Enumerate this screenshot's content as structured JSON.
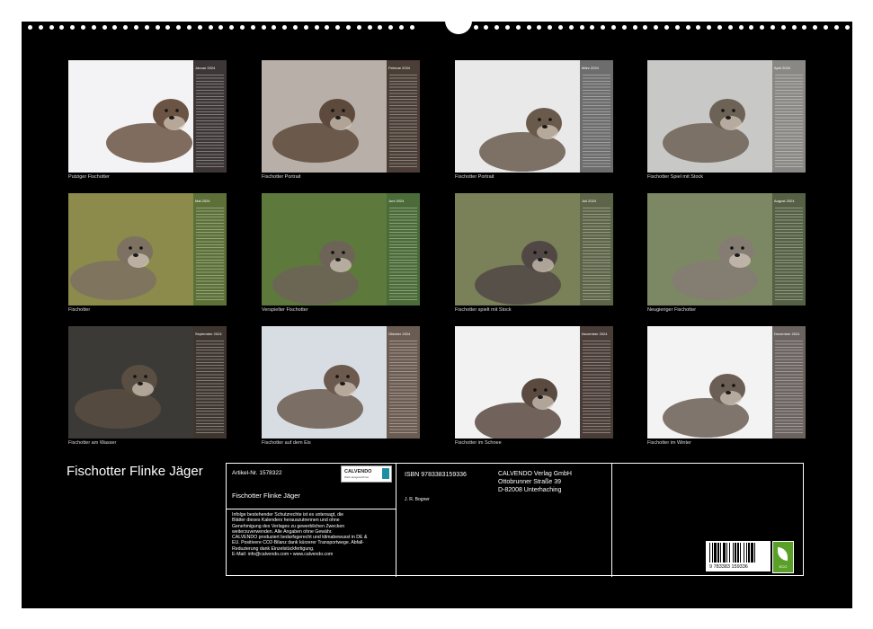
{
  "months": [
    {
      "label": "Januar 2024",
      "caption": "Putziger Fischotter",
      "strip_color": "#3d3636",
      "bg": "#f3f3f5"
    },
    {
      "label": "Februar 2024",
      "caption": "Fischotter Portrait",
      "strip_color": "#4a3e37",
      "bg": "#b8b0a8"
    },
    {
      "label": "März 2024",
      "caption": "Fischotter Portrait",
      "strip_color": "#6d6d6d",
      "bg": "#e9e9ea"
    },
    {
      "label": "April 2024",
      "caption": "Fischotter Spiel mit Stock",
      "strip_color": "#8a8885",
      "bg": "#c8c8c6"
    },
    {
      "label": "Mai 2024",
      "caption": "Fischotter",
      "strip_color": "#5c7038",
      "bg": "#8c8b4b"
    },
    {
      "label": "Juni 2024",
      "caption": "Verspielter Fischotter",
      "strip_color": "#4b6b38",
      "bg": "#5d7a3c"
    },
    {
      "label": "Juli 2024",
      "caption": "Fischotter spielt mit Stock",
      "strip_color": "#5e6448",
      "bg": "#7a8057"
    },
    {
      "label": "August 2024",
      "caption": "Neugieriger Fischotter",
      "strip_color": "#556044",
      "bg": "#7c8863"
    },
    {
      "label": "September 2024",
      "caption": "Fischotter am Wasser",
      "strip_color": "#3e352f",
      "bg": "#3b3a36"
    },
    {
      "label": "Oktober 2024",
      "caption": "Fischotter auf dem Eis",
      "strip_color": "#6b5c52",
      "bg": "#d7dde3"
    },
    {
      "label": "November 2024",
      "caption": "Fischotter im Schnee",
      "strip_color": "#4a3d38",
      "bg": "#f2f2f3"
    },
    {
      "label": "Dezember 2024",
      "caption": "Fischotter im Winter",
      "strip_color": "#6a6360",
      "bg": "#f3f3f3"
    }
  ],
  "title": "Fischotter Flinke Jäger",
  "info": {
    "artikel": "Artikel-Nr. 1578322",
    "product_title": "Fischotter Flinke Jäger",
    "isbn": "ISBN 9783383159336",
    "author": "J. R. Bogner",
    "publisher_name": "CALVENDO Verlag GmbH",
    "publisher_street": "Ottobrunner Straße 39",
    "publisher_city": "D-82008 Unterhaching",
    "legal_text": [
      "Infolge bestehender Schutzrechte ist es untersagt, die",
      "Blätter dieses Kalenders herauszutrennen und ohne",
      "Genehmigung des Verlages zu gewerblichen Zwecken",
      "weiterzuverwenden. Alle Angaben ohne Gewähr.",
      "CALVENDO produziert bedarfsgerecht und klimabewusst in DE &",
      "EU. Positivere CO2-Bilanz dank kürzerer Transportwege. Abfall-",
      "Reduzierung dank Einzelstückfertigung.",
      "E-Mail: info@calvendo.com • www.calvendo.com"
    ],
    "logo_text": "CALVENDO",
    "logo_sub": "Werk ausgezeichnet",
    "barcode_digits": "9 783383 159336",
    "eco_label": "ECO"
  }
}
